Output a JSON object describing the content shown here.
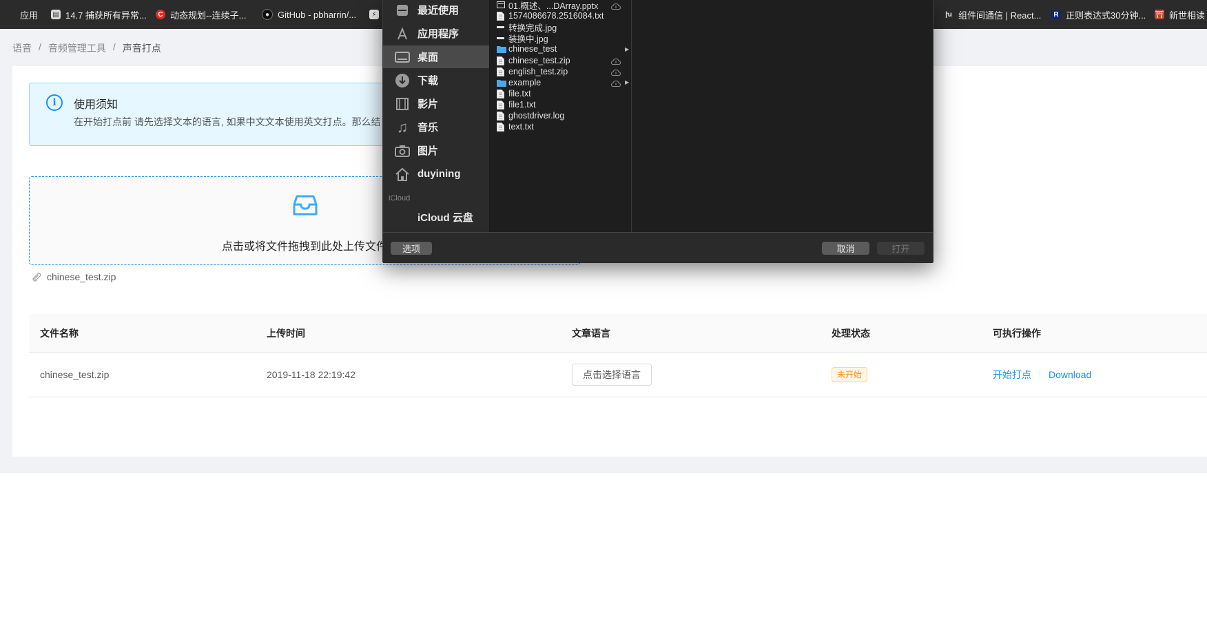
{
  "bookmarks": [
    {
      "label": "应用",
      "icon": "apps-grid-icon"
    },
    {
      "label": "14.7 捕获所有异常...",
      "icon": "doc-bookmark-icon"
    },
    {
      "label": "动态规划--连续子...",
      "icon": "csdn-icon"
    },
    {
      "label": "GitHub - pbharrin/...",
      "icon": "github-icon"
    },
    {
      "label": "组件间通信 | React...",
      "icon": "reading-icon"
    },
    {
      "label": "正则表达式30分钟...",
      "icon": "regex-icon"
    },
    {
      "label": "新世相读",
      "icon": "book-icon"
    }
  ],
  "breadcrumb": {
    "items": [
      "语音",
      "音频管理工具",
      "声音打点"
    ],
    "separator": "/"
  },
  "notice": {
    "title": "使用须知",
    "description": "在开始打点前 请先选择文本的语言, 如果中文文本使用英文打点。那么结"
  },
  "upload": {
    "text": "点击或将文件拖拽到此处上传文件"
  },
  "uploaded_file": {
    "name": "chinese_test.zip"
  },
  "table": {
    "columns": [
      "文件名称",
      "上传时间",
      "文章语言",
      "处理状态",
      "可执行操作"
    ],
    "rows": [
      {
        "filename": "chinese_test.zip",
        "uploaded_at": "2019-11-18 22:19:42",
        "language_button": "点击选择语言",
        "status": "未开始",
        "actions": [
          "开始打点",
          "Download"
        ]
      }
    ]
  },
  "dialog": {
    "sidebar": [
      {
        "label": "最近使用",
        "icon": "recents-icon"
      },
      {
        "label": "应用程序",
        "icon": "applications-icon"
      },
      {
        "label": "桌面",
        "icon": "desktop-icon",
        "selected": true
      },
      {
        "label": "下载",
        "icon": "downloads-icon"
      },
      {
        "label": "影片",
        "icon": "movies-icon"
      },
      {
        "label": "音乐",
        "icon": "music-icon"
      },
      {
        "label": "图片",
        "icon": "pictures-icon"
      },
      {
        "label": "duyining",
        "icon": "home-icon"
      }
    ],
    "icloud_section": "iCloud",
    "icloud_item": "iCloud 云盘",
    "files": [
      {
        "name": "01.概述、...DArray.pptx",
        "kind": "pptx",
        "cloud": true
      },
      {
        "name": "1574086678.2516084.txt",
        "kind": "txt"
      },
      {
        "name": "转换完成.jpg",
        "kind": "jpg"
      },
      {
        "name": "装换中.jpg",
        "kind": "jpg"
      },
      {
        "name": "chinese_test",
        "kind": "folder",
        "arrow": true
      },
      {
        "name": "chinese_test.zip",
        "kind": "zip",
        "cloud": true
      },
      {
        "name": "english_test.zip",
        "kind": "zip",
        "cloud": true
      },
      {
        "name": "example",
        "kind": "folder",
        "cloud": true,
        "arrow": true
      },
      {
        "name": "file.txt",
        "kind": "txt"
      },
      {
        "name": "file1.txt",
        "kind": "txt"
      },
      {
        "name": "ghostdriver.log",
        "kind": "log"
      },
      {
        "name": "text.txt",
        "kind": "txt"
      }
    ],
    "options_button": "选项",
    "cancel_button": "取消",
    "open_button": "打开"
  },
  "colors": {
    "primary": "#1890ff",
    "notice_bg": "#e6f7ff",
    "status_tag": "#fa8c16",
    "dialog_bg": "#1e1e1e",
    "bookmarks_bg": "#2b2b2b"
  }
}
